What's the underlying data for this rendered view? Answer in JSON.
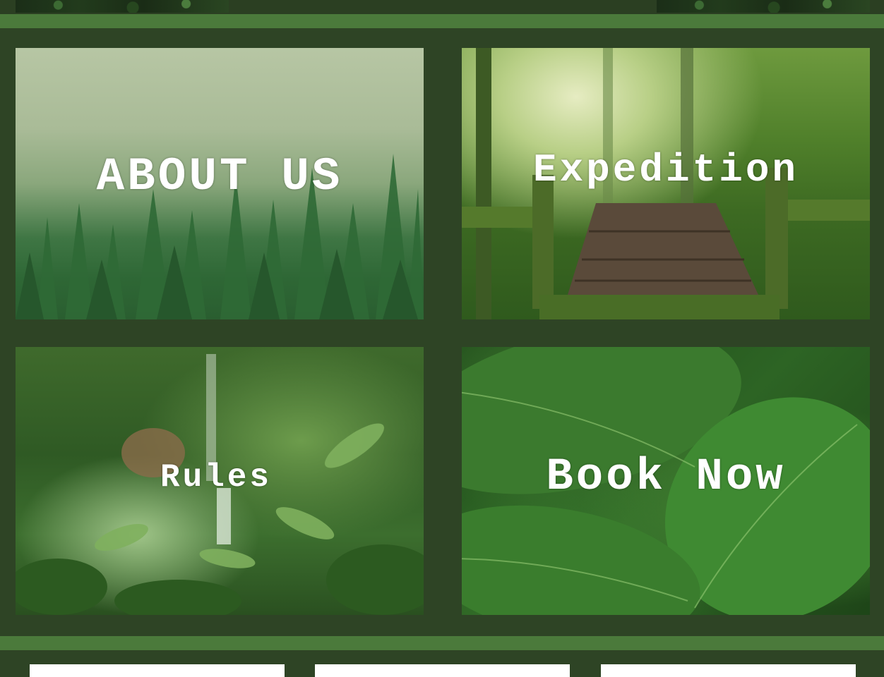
{
  "header": {
    "leaf_banner_left": "leaf-banner",
    "leaf_banner_right": "leaf-banner"
  },
  "tiles": [
    {
      "label": "ABOUT US",
      "image": "misty-forest"
    },
    {
      "label": "Expedition",
      "image": "jungle-boardwalk"
    },
    {
      "label": "Rules",
      "image": "waterfall-garden"
    },
    {
      "label": "Book Now",
      "image": "green-leaves"
    }
  ],
  "colors": {
    "background": "#2e4425",
    "band": "#4b7a3b",
    "label_text": "#ffffff",
    "card": "#ffffff"
  }
}
